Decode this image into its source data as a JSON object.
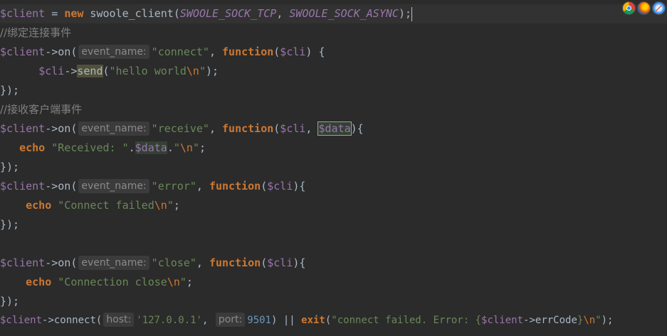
{
  "code": {
    "l1": {
      "v1": "$client",
      "op1": " = ",
      "kw_new": "new",
      "fn": " swoole_client(",
      "c1": "SWOOLE_SOCK_TCP",
      "comma": ", ",
      "c2": "SWOOLE_SOCK_ASYNC",
      "end": ");"
    },
    "l2": {
      "comment": "//绑定连接事件"
    },
    "l3": {
      "v": "$client",
      "arrow": "->on(",
      "hint": "event_name:",
      "s": "\"connect\"",
      "comma": ", ",
      "kw": "function",
      "p1": "(",
      "v2": "$cli",
      "p2": ") {"
    },
    "l4": {
      "indent": "      ",
      "v": "$cli",
      "arrow": "->",
      "fn": "send",
      "p1": "(",
      "s1": "\"hello world",
      "esc": "\\n",
      "s2": "\"",
      "end": ");"
    },
    "l5": {
      "t": "});"
    },
    "l6": {
      "comment": "//接收客户端事件"
    },
    "l7": {
      "v": "$client",
      "arrow": "->on(",
      "hint": "event_name:",
      "s": "\"receive\"",
      "comma": ", ",
      "kw": "function",
      "p1": "(",
      "v2": "$cli",
      "comma2": ", ",
      "v3": "$data",
      "p2": "){"
    },
    "l8": {
      "indent": "   ",
      "kw": "echo",
      "s1": " \"Received: \"",
      "dot": ".",
      "v": "$data",
      "dot2": ".",
      "s2": "\"",
      "esc": "\\n",
      "s3": "\"",
      "end": ";"
    },
    "l9": {
      "t": "});"
    },
    "l10": {
      "v": "$client",
      "arrow": "->on(",
      "hint": "event_name:",
      "s": "\"error\"",
      "comma": ", ",
      "kw": "function",
      "p1": "(",
      "v2": "$cli",
      "p2": "){"
    },
    "l11": {
      "indent": "    ",
      "kw": "echo",
      "s1": " \"Connect failed",
      "esc": "\\n",
      "s2": "\"",
      "end": ";"
    },
    "l12": {
      "t": "});"
    },
    "l14": {
      "v": "$client",
      "arrow": "->on(",
      "hint": "event_name:",
      "s": "\"close\"",
      "comma": ", ",
      "kw": "function",
      "p1": "(",
      "v2": "$cli",
      "p2": "){"
    },
    "l15": {
      "indent": "    ",
      "kw": "echo",
      "s1": " \"Connection close",
      "esc": "\\n",
      "s2": "\"",
      "end": ";"
    },
    "l16": {
      "t": "});"
    },
    "l17": {
      "v": "$client",
      "arrow": "->connect(",
      "hint1": "host:",
      "s1": "'127.0.0.1'",
      "comma": ", ",
      "hint2": "port:",
      "num": "9501",
      "p": ") || ",
      "kw": "exit",
      "p2": "(",
      "s2": "\"connect failed. Error: {",
      "v2": "$client",
      "arrow2": "->errCode",
      "s3": "}",
      "esc": "\\n",
      "s4": "\"",
      "end": ");"
    }
  },
  "browser_icons": [
    "chrome-icon",
    "firefox-icon",
    "safari-icon"
  ]
}
